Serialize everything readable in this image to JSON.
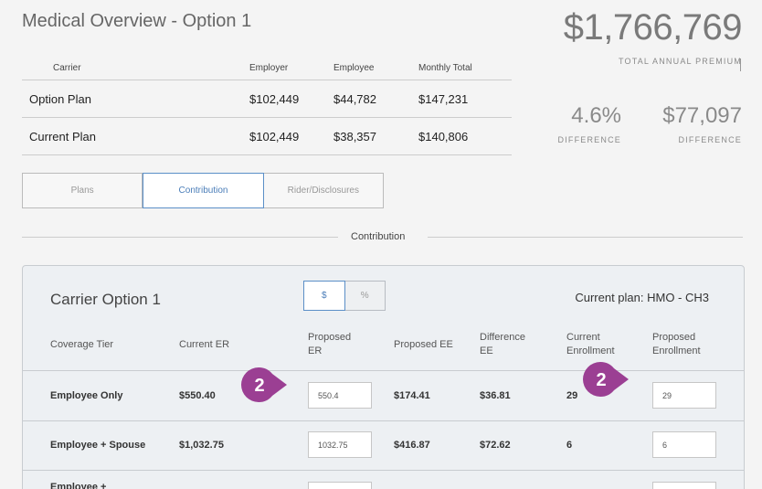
{
  "header": {
    "title": "Medical Overview - Option 1",
    "total_premium": "$1,766,769",
    "total_premium_label": "TOTAL ANNUAL PREMIUM",
    "diff_percent": "4.6%",
    "diff_percent_label": "DIFFERENCE",
    "diff_amount": "$77,097",
    "diff_amount_label": "DIFFERENCE"
  },
  "summary": {
    "columns": [
      "Carrier",
      "Employer",
      "Employee",
      "Monthly Total"
    ],
    "rows": [
      [
        "Option Plan",
        "$102,449",
        "$44,782",
        "$147,231"
      ],
      [
        "Current Plan",
        "$102,449",
        "$38,357",
        "$140,806"
      ]
    ]
  },
  "tabs": [
    "Plans",
    "Contribution",
    "Rider/Disclosures"
  ],
  "active_tab": "Contribution",
  "section_label": "Contribution",
  "card": {
    "title": "Carrier Option 1",
    "toggle": [
      "$",
      "%"
    ],
    "current_plan": "Current plan: HMO - CH3",
    "columns": [
      "Coverage Tier",
      "Current ER",
      "Proposed ER",
      "Proposed EE",
      "Difference EE",
      "Current Enrollment",
      "Proposed Enrollment"
    ],
    "col_lines": [
      [
        "Coverage Tier"
      ],
      [
        "Current ER"
      ],
      [
        "Proposed",
        "ER"
      ],
      [
        "Proposed EE"
      ],
      [
        "Difference",
        "EE"
      ],
      [
        "Current",
        "Enrollment"
      ],
      [
        "Proposed",
        "Enrollment"
      ]
    ],
    "rows": [
      {
        "tier": "Employee Only",
        "current_er": "$550.40",
        "proposed_er": "550.4",
        "proposed_ee": "$174.41",
        "diff_ee": "$36.81",
        "current_enroll": "29",
        "proposed_enroll": "29"
      },
      {
        "tier": "Employee + Spouse",
        "current_er": "$1,032.75",
        "proposed_er": "1032.75",
        "proposed_ee": "$416.87",
        "diff_ee": "$72.62",
        "current_enroll": "6",
        "proposed_enroll": "6"
      },
      {
        "tier": "Employee +",
        "current_er": "",
        "proposed_er": "",
        "proposed_ee": "",
        "diff_ee": "",
        "current_enroll": "",
        "proposed_enroll": ""
      }
    ]
  },
  "badges": [
    "2",
    "2"
  ],
  "colors": {
    "accent": "#5b8fc7",
    "badge": "#9b3f93"
  }
}
